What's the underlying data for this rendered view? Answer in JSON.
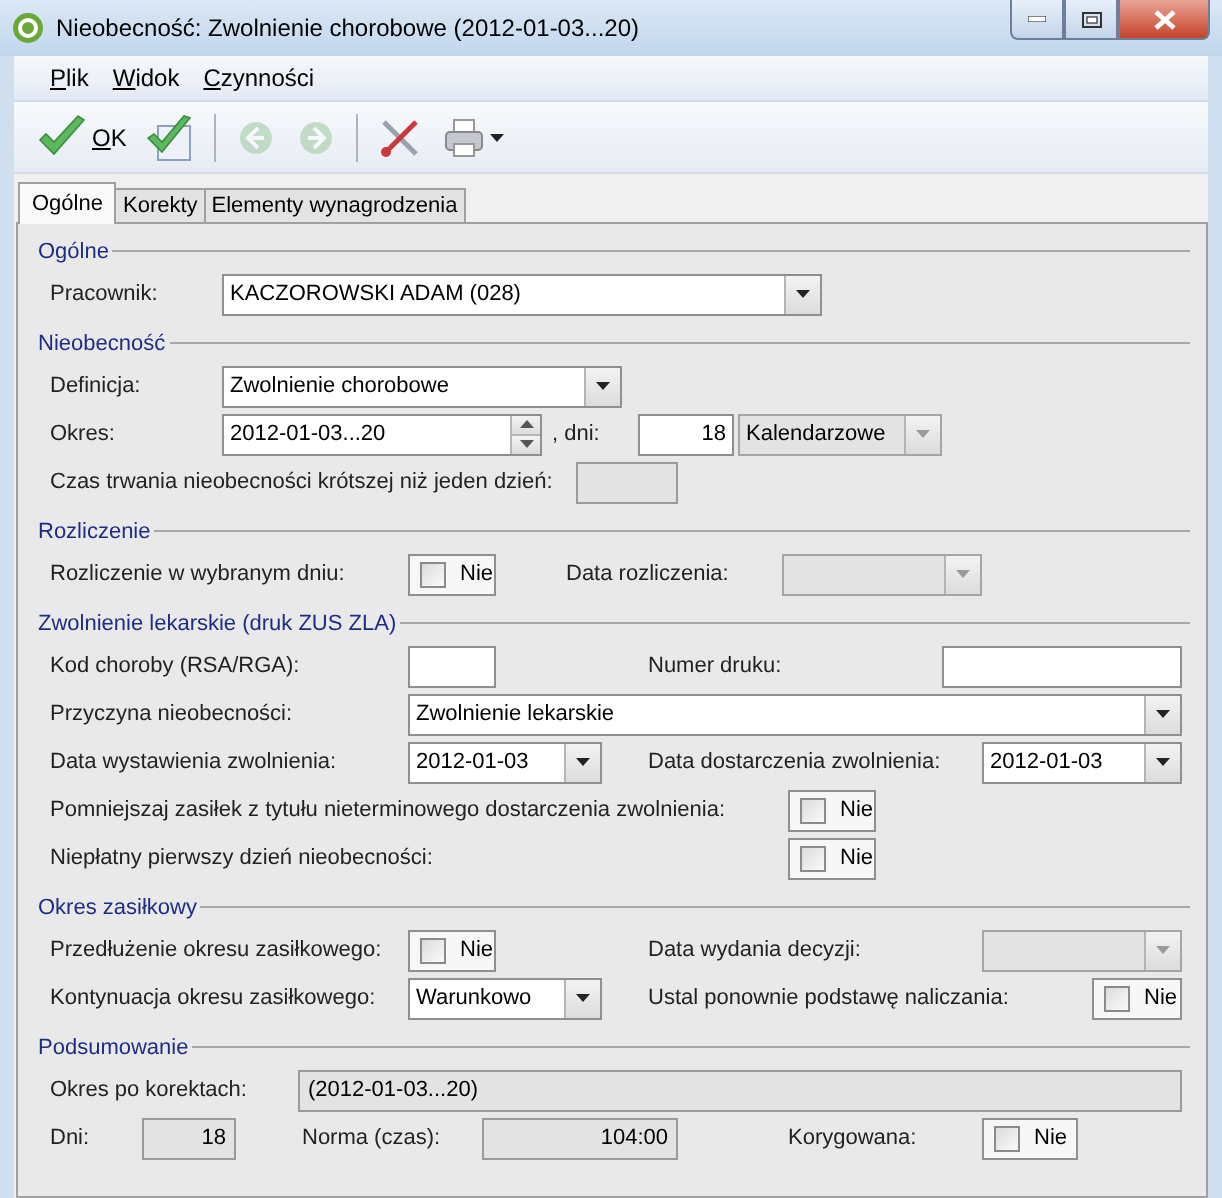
{
  "window": {
    "title": "Nieobecność: Zwolnienie chorobowe (2012-01-03...20)"
  },
  "menu": [
    {
      "label": "Plik",
      "accelerator": true
    },
    {
      "label": "Widok",
      "accelerator": true
    },
    {
      "label": "Czynności",
      "accelerator": true
    }
  ],
  "toolbar": {
    "buttons": [
      {
        "kind": "ok",
        "label": "OK",
        "accelerator": true,
        "disabled": false
      },
      {
        "kind": "save-new",
        "disabled": false
      },
      {
        "kind": "back",
        "disabled": true
      },
      {
        "kind": "forward",
        "disabled": true
      },
      {
        "kind": "tools",
        "disabled": false
      },
      {
        "kind": "print",
        "disabled": false
      }
    ]
  },
  "tabs": [
    {
      "label": "Ogólne",
      "selected": true
    },
    {
      "label": "Korekty",
      "selected": false
    },
    {
      "label": "Elementy wynagrodzenia",
      "selected": false
    }
  ],
  "sections": [
    {
      "title": "Ogólne",
      "rows": [
        {
          "items": [
            {
              "kind": "label",
              "text": "Pracownik:"
            },
            {
              "kind": "combo",
              "value": "KACZOROWSKI ADAM (028)",
              "disabled": false
            }
          ]
        }
      ]
    },
    {
      "title": "Nieobecność",
      "rows": [
        {
          "items": [
            {
              "kind": "label",
              "text": "Definicja:"
            },
            {
              "kind": "combo",
              "value": "Zwolnienie chorobowe",
              "disabled": false
            }
          ]
        },
        {
          "items": [
            {
              "kind": "label",
              "text": "Okres:"
            },
            {
              "kind": "spin",
              "value": "2012-01-03...20"
            },
            {
              "kind": "label",
              "text": ", dni:"
            },
            {
              "kind": "input",
              "value": "18"
            },
            {
              "kind": "combo",
              "value": "Kalendarzowe",
              "disabled": true
            }
          ]
        },
        {
          "items": [
            {
              "kind": "label",
              "text": "Czas trwania nieobecności krótszej niż jeden dzień:"
            },
            {
              "kind": "readonly"
            }
          ]
        }
      ]
    },
    {
      "title": "Rozliczenie",
      "rows": [
        {
          "items": [
            {
              "kind": "label",
              "text": "Rozliczenie w wybranym dniu:"
            },
            {
              "kind": "checkbox",
              "label": "Nie",
              "checked": false
            },
            {
              "kind": "label",
              "text": "Data rozliczenia:"
            },
            {
              "kind": "combo",
              "disabled": true
            }
          ]
        }
      ]
    },
    {
      "title": "Zwolnienie lekarskie (druk ZUS ZLA)",
      "rows": [
        {
          "items": [
            {
              "kind": "label",
              "text": "Kod choroby (RSA/RGA):"
            },
            {
              "kind": "input"
            },
            {
              "kind": "label",
              "text": "Numer druku:"
            },
            {
              "kind": "input"
            }
          ]
        },
        {
          "items": [
            {
              "kind": "label",
              "text": "Przyczyna nieobecności:"
            },
            {
              "kind": "combo",
              "value": "Zwolnienie lekarskie",
              "disabled": false
            }
          ]
        },
        {
          "items": [
            {
              "kind": "label",
              "text": "Data wystawienia zwolnienia:"
            },
            {
              "kind": "combo",
              "value": "2012-01-03",
              "disabled": false
            },
            {
              "kind": "label",
              "text": "Data dostarczenia zwolnienia:"
            },
            {
              "kind": "combo",
              "value": "2012-01-03",
              "disabled": false
            }
          ]
        },
        {
          "items": [
            {
              "kind": "label",
              "text": "Pomniejszaj zasiłek z tytułu nieterminowego dostarczenia zwolnienia:"
            },
            {
              "kind": "checkbox",
              "label": "Nie",
              "checked": false
            }
          ]
        },
        {
          "items": [
            {
              "kind": "label",
              "text": "Niepłatny pierwszy dzień nieobecności:"
            },
            {
              "kind": "checkbox",
              "label": "Nie",
              "checked": false
            }
          ]
        }
      ]
    },
    {
      "title": "Okres zasiłkowy",
      "rows": [
        {
          "items": [
            {
              "kind": "label",
              "text": "Przedłużenie okresu zasiłkowego:"
            },
            {
              "kind": "checkbox",
              "label": "Nie",
              "checked": false
            },
            {
              "kind": "label",
              "text": "Data wydania decyzji:"
            },
            {
              "kind": "combo",
              "disabled": true
            }
          ]
        },
        {
          "items": [
            {
              "kind": "label",
              "text": "Kontynuacja okresu zasiłkowego:"
            },
            {
              "kind": "combo",
              "value": "Warunkowo",
              "disabled": false
            },
            {
              "kind": "label",
              "text": "Ustal ponownie podstawę naliczania:"
            },
            {
              "kind": "checkbox",
              "label": "Nie",
              "checked": false
            }
          ]
        }
      ]
    },
    {
      "title": "Podsumowanie",
      "rows": [
        {
          "items": [
            {
              "kind": "label",
              "text": "Okres po korektach:"
            },
            {
              "kind": "readonly",
              "value": "(2012-01-03...20)"
            }
          ]
        },
        {
          "items": [
            {
              "kind": "label",
              "text": "Dni:"
            },
            {
              "kind": "readonly",
              "value": "18"
            },
            {
              "kind": "label",
              "text": "Norma (czas):"
            },
            {
              "kind": "readonly",
              "value": "104:00"
            },
            {
              "kind": "label",
              "text": "Korygowana:"
            },
            {
              "kind": "checkbox",
              "label": "Nie",
              "checked": false
            }
          ]
        }
      ]
    }
  ]
}
